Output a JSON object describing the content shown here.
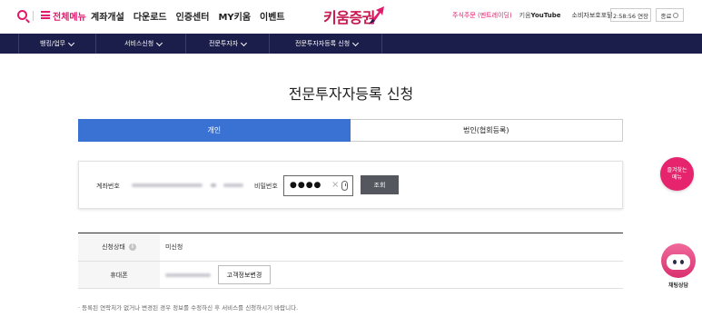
{
  "header": {
    "all_menu": "전체메뉴",
    "nav": [
      "계좌개설",
      "다운로드",
      "인증센터",
      "MY키움",
      "이벤트"
    ],
    "logo_text": "키움증권",
    "right": {
      "order": "주식주문 (멘트레이딩)",
      "youtube_prefix": "키움",
      "youtube_word": "YouTube",
      "consumer": "소비자보호포털",
      "timer": "2:58:56 연장",
      "exit": "종료"
    }
  },
  "navbar": [
    "뱅킹/업무",
    "서비스신청",
    "전문투자자",
    "전문투자자등록 신청"
  ],
  "main": {
    "title": "전문투자자등록 신청",
    "tabs": [
      {
        "label": "개인",
        "active": true
      },
      {
        "label": "법인(협회등록)",
        "active": false
      }
    ],
    "account": {
      "label": "계좌번호",
      "password_label": "비밀번호",
      "password_value": "●●●●",
      "search_button": "조회"
    },
    "info": {
      "status_label": "신청상태",
      "status_value": "미신청",
      "phone_label": "휴대폰",
      "change_button": "고객정보변경"
    },
    "note": "· 등록된 연락처가 없거나 변경된 경우 정보를 수정하신 후 서비스를 신청하시기 바랍니다."
  },
  "floating": {
    "favorites": [
      "즐겨찾는",
      "메뉴"
    ],
    "chat_label": "채팅상담"
  },
  "colors": {
    "brand": "#e11a6c",
    "navbar": "#1b1e4a",
    "tab_active": "#3a72d4"
  },
  "icons": [
    "search-icon",
    "hamburger-menu-icon",
    "info-icon",
    "clear-icon",
    "virtual-keyboard-icon",
    "chatbot-icon"
  ]
}
